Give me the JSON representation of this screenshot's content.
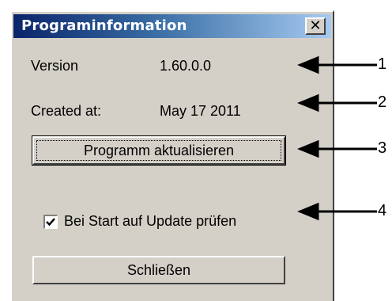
{
  "window": {
    "title": "Programinformation",
    "close_glyph": "✕"
  },
  "info": {
    "version_label": "Version",
    "version_value": "1.60.0.0",
    "created_label": "Created at:",
    "created_value": "May 17 2011"
  },
  "buttons": {
    "update_label": "Programm aktualisieren",
    "close_label": "Schließen"
  },
  "checkbox": {
    "label": "Bei Start auf Update prüfen",
    "checked": true
  },
  "callouts": [
    "1",
    "2",
    "3",
    "4"
  ]
}
